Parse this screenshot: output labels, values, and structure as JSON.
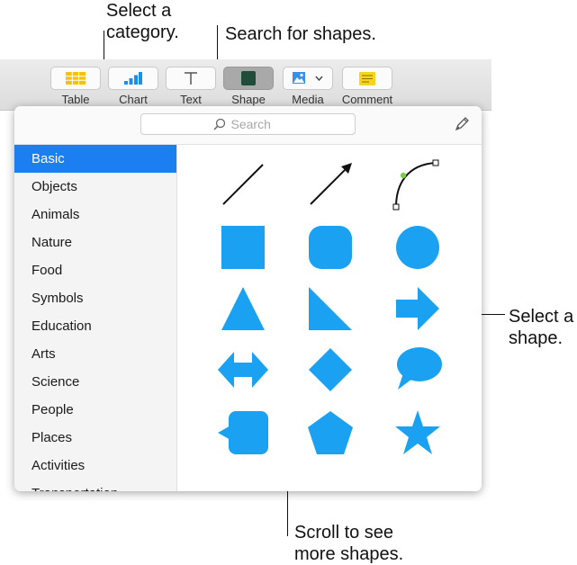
{
  "callouts": {
    "category": "Select a\ncategory.",
    "search": "Search for shapes.",
    "select_shape": "Select a\nshape.",
    "scroll": "Scroll to see\nmore shapes."
  },
  "toolbar": {
    "buttons": [
      {
        "label": "Table",
        "icon": "table-icon"
      },
      {
        "label": "Chart",
        "icon": "chart-icon"
      },
      {
        "label": "Text",
        "icon": "text-icon"
      },
      {
        "label": "Shape",
        "icon": "shape-icon"
      },
      {
        "label": "Media",
        "icon": "media-icon"
      },
      {
        "label": "Comment",
        "icon": "comment-icon"
      }
    ]
  },
  "popover": {
    "search_placeholder": "Search",
    "categories": [
      "Basic",
      "Objects",
      "Animals",
      "Nature",
      "Food",
      "Symbols",
      "Education",
      "Arts",
      "Science",
      "People",
      "Places",
      "Activities",
      "Transportation"
    ],
    "selected_category": "Basic",
    "shapes": [
      "line",
      "arrow-line",
      "curve",
      "square",
      "rounded-square",
      "circle",
      "triangle",
      "right-triangle",
      "arrow",
      "double-arrow",
      "diamond",
      "speech-bubble",
      "callout-square",
      "pentagon",
      "star"
    ]
  },
  "colors": {
    "shape_fill": "#1ba1f2",
    "selection": "#1b7ff2",
    "chart_icon": "#1b8ef2",
    "table_icon": "#f4c20d",
    "shape_icon": "#1f4d3a",
    "media_icon": "#3a8ee6",
    "comment_icon": "#f7d51d",
    "curve_point": "#7ccf4a"
  }
}
